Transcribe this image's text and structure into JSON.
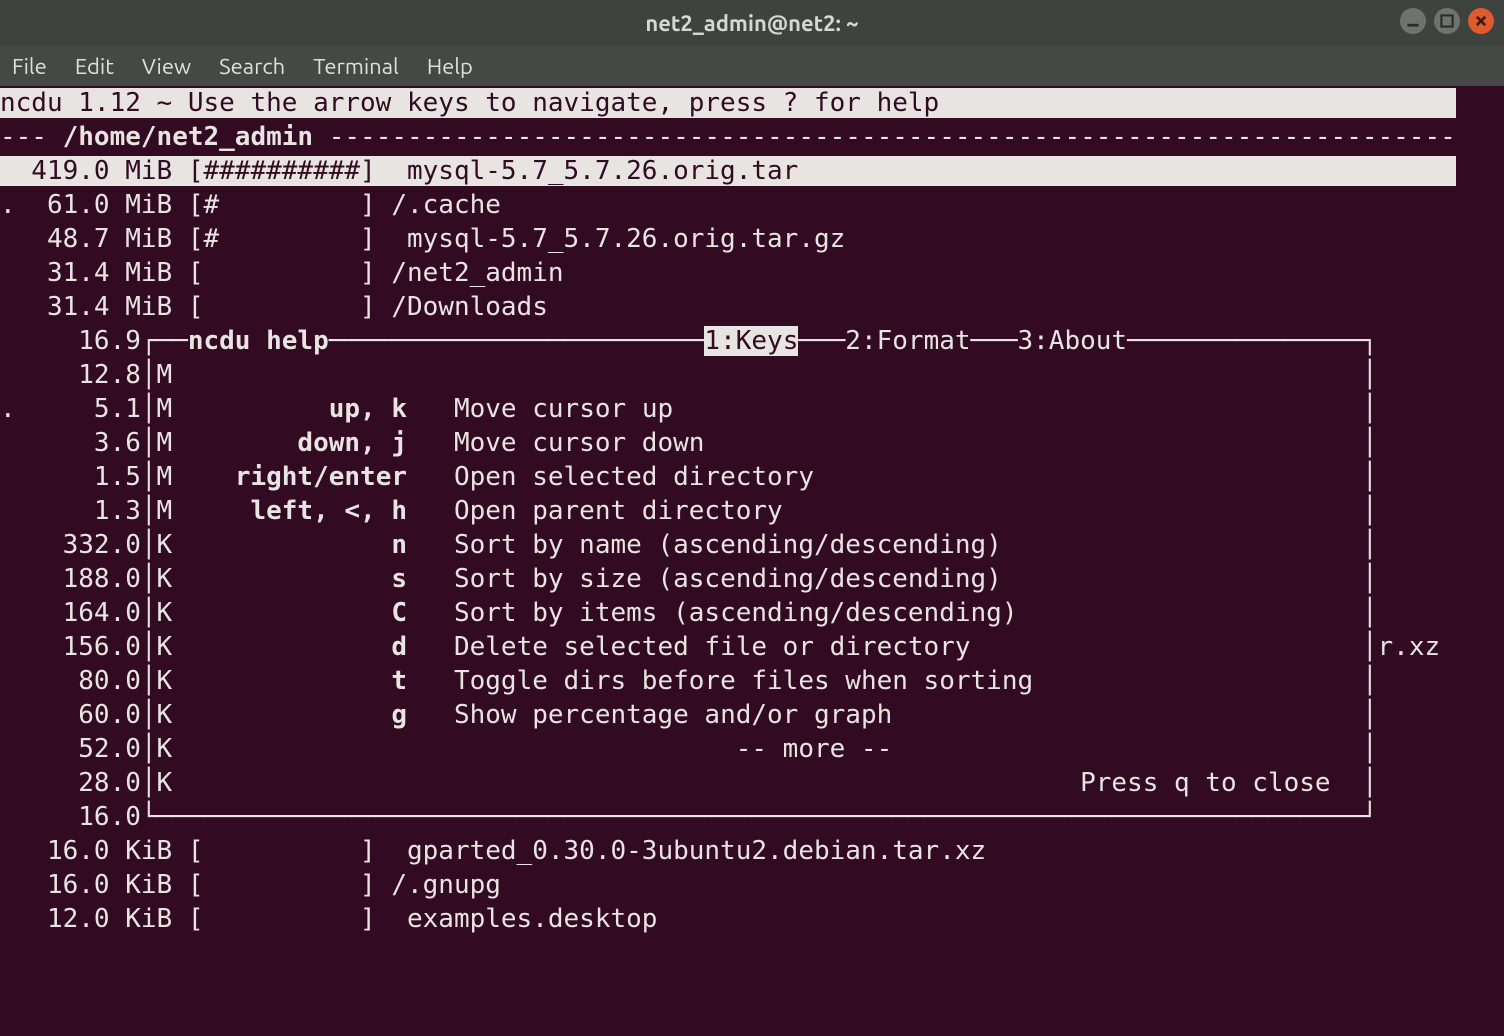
{
  "window": {
    "title": "net2_admin@net2: ~"
  },
  "menubar": [
    "File",
    "Edit",
    "View",
    "Search",
    "Terminal",
    "Help"
  ],
  "header": "ncdu 1.12 ~ Use the arrow keys to navigate, press ? for help",
  "path_prefix": "--- ",
  "path": "/home/net2_admin",
  "rows": [
    {
      "prefix": " ",
      "size": "419.0 MiB",
      "bar": "[##########]",
      "name": " mysql-5.7_5.7.26.orig.tar",
      "selected": true
    },
    {
      "prefix": ".",
      "size": "61.0 MiB",
      "bar": "[#         ]",
      "name": "/.cache"
    },
    {
      "prefix": " ",
      "size": "48.7 MiB",
      "bar": "[#         ]",
      "name": " mysql-5.7_5.7.26.orig.tar.gz"
    },
    {
      "prefix": " ",
      "size": "31.4 MiB",
      "bar": "[          ]",
      "name": "/net2_admin"
    },
    {
      "prefix": " ",
      "size": "31.4 MiB",
      "bar": "[          ]",
      "name": "/Downloads"
    },
    {
      "prefix": " ",
      "size": "16.9 M"
    },
    {
      "prefix": " ",
      "size": "12.8 M"
    },
    {
      "prefix": ".",
      "size": "5.1 M"
    },
    {
      "prefix": " ",
      "size": "3.6 M"
    },
    {
      "prefix": " ",
      "size": "1.5 M"
    },
    {
      "prefix": " ",
      "size": "1.3 M"
    },
    {
      "prefix": " ",
      "size": "332.0 K"
    },
    {
      "prefix": " ",
      "size": "188.0 K"
    },
    {
      "prefix": " ",
      "size": "164.0 K"
    },
    {
      "prefix": " ",
      "size": "156.0 K",
      "tail": "r.xz"
    },
    {
      "prefix": " ",
      "size": "80.0 K"
    },
    {
      "prefix": " ",
      "size": "60.0 K"
    },
    {
      "prefix": " ",
      "size": "52.0 K"
    },
    {
      "prefix": " ",
      "size": "28.0 K"
    },
    {
      "prefix": " ",
      "size": "16.0 K"
    },
    {
      "prefix": " ",
      "size": "16.0 KiB",
      "bar": "[          ]",
      "name": " gparted_0.30.0-3ubuntu2.debian.tar.xz"
    },
    {
      "prefix": " ",
      "size": "16.0 KiB",
      "bar": "[          ]",
      "name": "/.gnupg"
    },
    {
      "prefix": " ",
      "size": "12.0 KiB",
      "bar": "[          ]",
      "name": " examples.desktop"
    }
  ],
  "help": {
    "title": "ncdu help",
    "tabs": [
      "1:Keys",
      "2:Format",
      "3:About"
    ],
    "active_tab": 0,
    "keys": [
      {
        "k": "up, k",
        "d": "Move cursor up"
      },
      {
        "k": "down, j",
        "d": "Move cursor down"
      },
      {
        "k": "right/enter",
        "d": "Open selected directory"
      },
      {
        "k": "left, <, h",
        "d": "Open parent directory"
      },
      {
        "k": "n",
        "d": "Sort by name (ascending/descending)"
      },
      {
        "k": "s",
        "d": "Sort by size (ascending/descending)"
      },
      {
        "k": "C",
        "d": "Sort by items (ascending/descending)"
      },
      {
        "k": "d",
        "d": "Delete selected file or directory"
      },
      {
        "k": "t",
        "d": "Toggle dirs before files when sorting"
      },
      {
        "k": "g",
        "d": "Show percentage and/or graph"
      }
    ],
    "more": "-- more --",
    "close_hint": "Press q to close"
  }
}
